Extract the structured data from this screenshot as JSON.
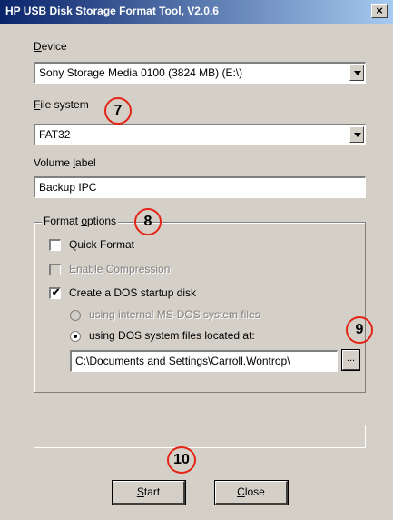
{
  "window": {
    "title": "HP USB Disk Storage Format Tool, V2.0.6",
    "close_symbol": "×"
  },
  "device": {
    "label_key": "D",
    "label_rest": "evice",
    "selected": "Sony Storage Media 0100 (3824 MB) (E:\\)"
  },
  "file_system": {
    "label_key": "F",
    "label_rest": "ile system",
    "selected": "FAT32"
  },
  "volume_label": {
    "label_pre": "Volume ",
    "label_key": "l",
    "label_rest": "abel",
    "value": "Backup IPC"
  },
  "format_options": {
    "label_pre": "Format ",
    "label_key": "o",
    "label_rest": "ptions",
    "quick_format": {
      "label": "Quick Format",
      "checked": false
    },
    "enable_compression": {
      "label": "Enable Compression",
      "checked": false,
      "disabled": true
    },
    "dos_startup": {
      "label": "Create a DOS startup disk",
      "checked": true,
      "check_mark": "✔"
    },
    "radio_internal": {
      "label": "using internal MS-DOS system files",
      "disabled": true
    },
    "radio_located": {
      "label": "using DOS system files located at:",
      "selected": true
    },
    "dos_path": "C:\\Documents and Settings\\Carroll.Wontrop\\",
    "browse_label": "..."
  },
  "buttons": {
    "start_key": "S",
    "start_rest": "tart",
    "close_key": "C",
    "close_rest": "lose"
  },
  "annotations": {
    "m7": "7",
    "m8": "8",
    "m9": "9",
    "m10": "10",
    "color": "#e32416"
  }
}
